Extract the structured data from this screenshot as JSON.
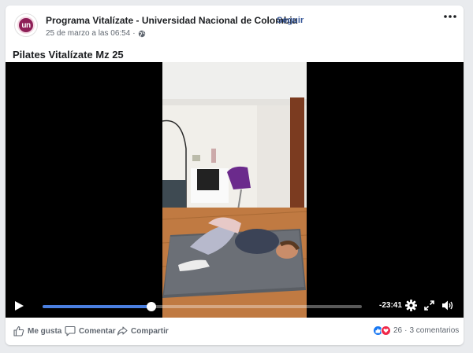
{
  "post": {
    "page_name": "Programa Vitalízate - Universidad Nacional de Colombia",
    "separator": "·",
    "follow_label": "Seguir",
    "timestamp": "25 de marzo a las 06:54",
    "separator2": "·",
    "avatar_text": "un",
    "title": "Pilates Vitalízate Mz 25"
  },
  "video": {
    "progress_fraction": 0.34,
    "time_remaining": "-23:41"
  },
  "actions": {
    "like_label": "Me gusta",
    "comment_label": "Comentar",
    "share_label": "Compartir"
  },
  "reactions": {
    "count": "26",
    "separator": "·",
    "comments": "3 comentarios"
  },
  "colors": {
    "accent": "#385898",
    "progress": "#4a7fe0",
    "like_blue": "#1877f2",
    "love_red": "#f02849",
    "brand": "#8e1f57"
  },
  "icons": [
    "more-options-icon",
    "globe-icon",
    "play-icon",
    "gear-icon",
    "fullscreen-icon",
    "volume-icon",
    "like-icon",
    "comment-icon",
    "share-icon",
    "like-reaction-icon",
    "love-reaction-icon"
  ]
}
